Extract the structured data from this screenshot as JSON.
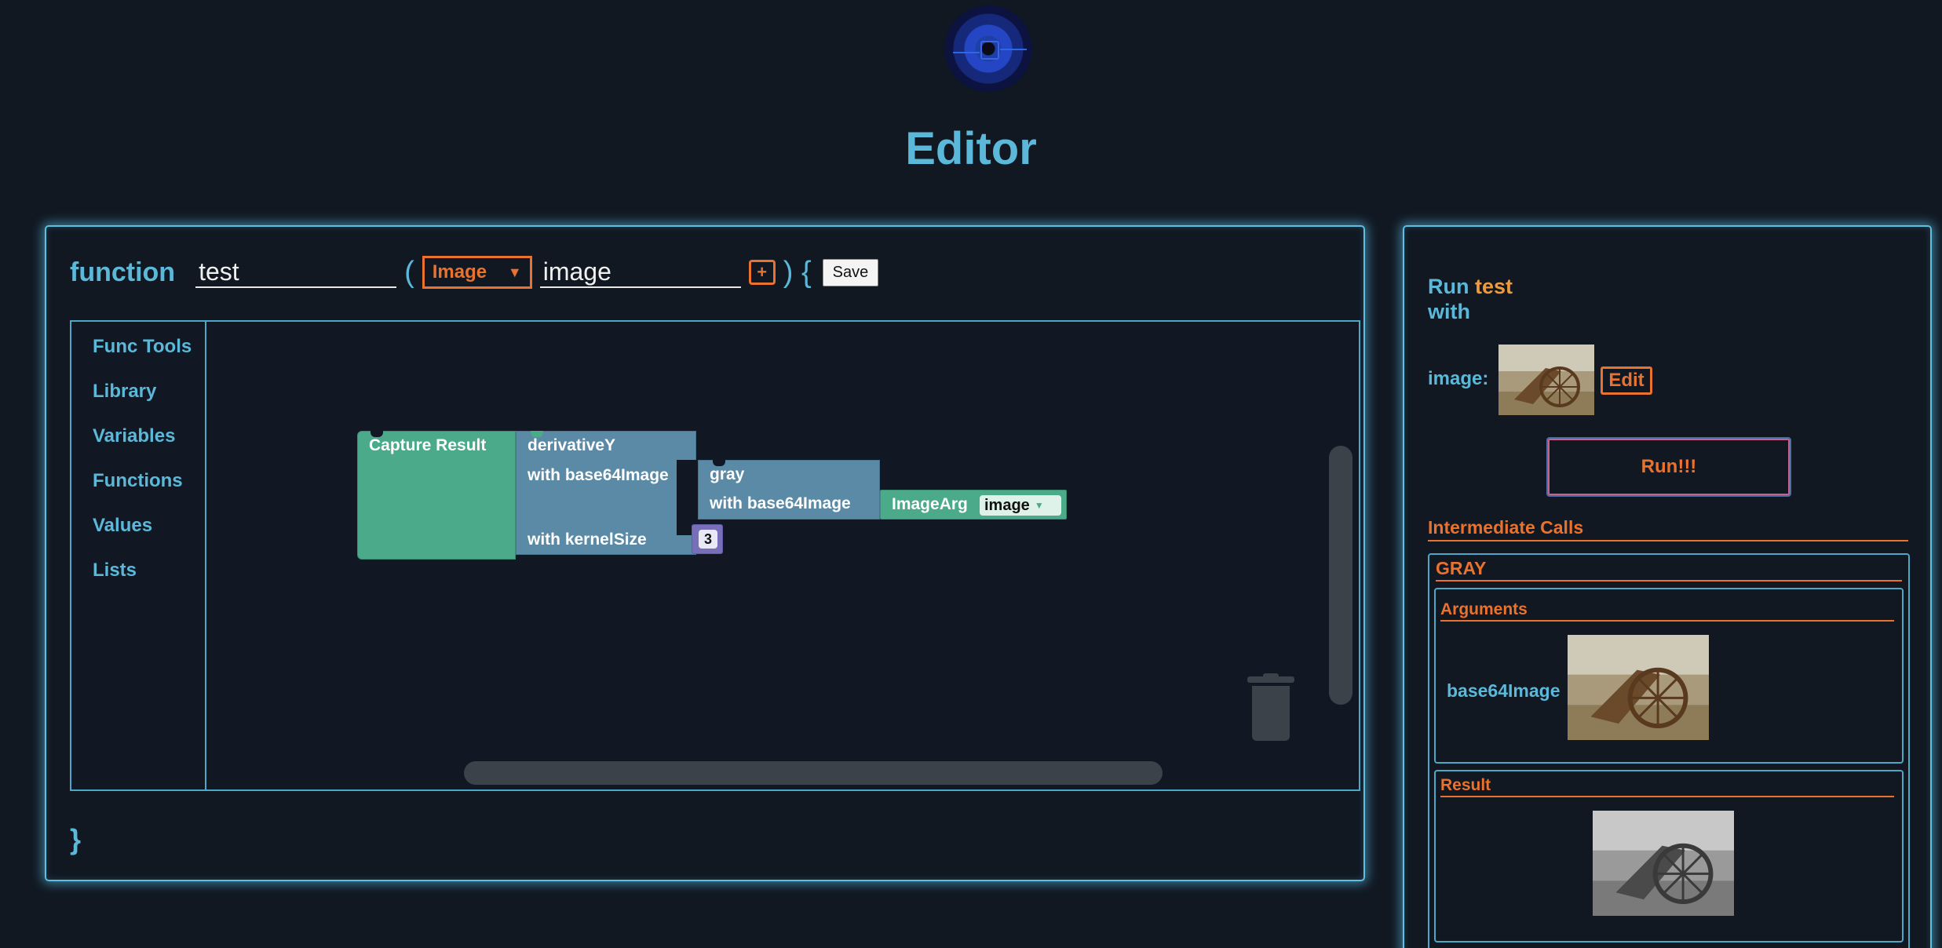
{
  "page": {
    "title": "Editor"
  },
  "editor": {
    "keyword": "function",
    "function_name": "test",
    "open_paren": "(",
    "param_type": "Image",
    "param_type_caret": "▼",
    "param_name": "image",
    "add_param_label": "+",
    "close_paren_brace": ") {",
    "save_label": "Save",
    "close_brace": "}"
  },
  "toolbox": {
    "items": [
      {
        "label": "Func Tools"
      },
      {
        "label": "Library"
      },
      {
        "label": "Variables"
      },
      {
        "label": "Functions"
      },
      {
        "label": "Values"
      },
      {
        "label": "Lists"
      }
    ]
  },
  "blocks": {
    "capture": {
      "label": "Capture Result",
      "color": "#4aaa8a"
    },
    "derivative": {
      "label": "derivativeY",
      "arg1": "with base64Image",
      "arg2": "with kernelSize",
      "color": "#5a8aa6"
    },
    "gray": {
      "label": "gray",
      "arg1": "with base64Image",
      "color": "#5a8aa6"
    },
    "image_arg": {
      "label": "ImageArg",
      "value": "image",
      "caret": "▼",
      "color": "#4aaa8a"
    },
    "kernel_size": {
      "value": "3",
      "color": "#7770b8"
    }
  },
  "run_panel": {
    "run_label": "Run",
    "function_name": "test",
    "with_label": "with",
    "arg_label": "image:",
    "edit_label": "Edit",
    "run_button_label": "Run!!!",
    "intermediate_title": "Intermediate Calls",
    "call": {
      "name": "GRAY",
      "arguments_title": "Arguments",
      "arg_name": "base64Image",
      "result_title": "Result"
    }
  },
  "colors": {
    "accent_blue": "#5bb8d9",
    "accent_orange": "#e8722e",
    "background": "#111822"
  }
}
